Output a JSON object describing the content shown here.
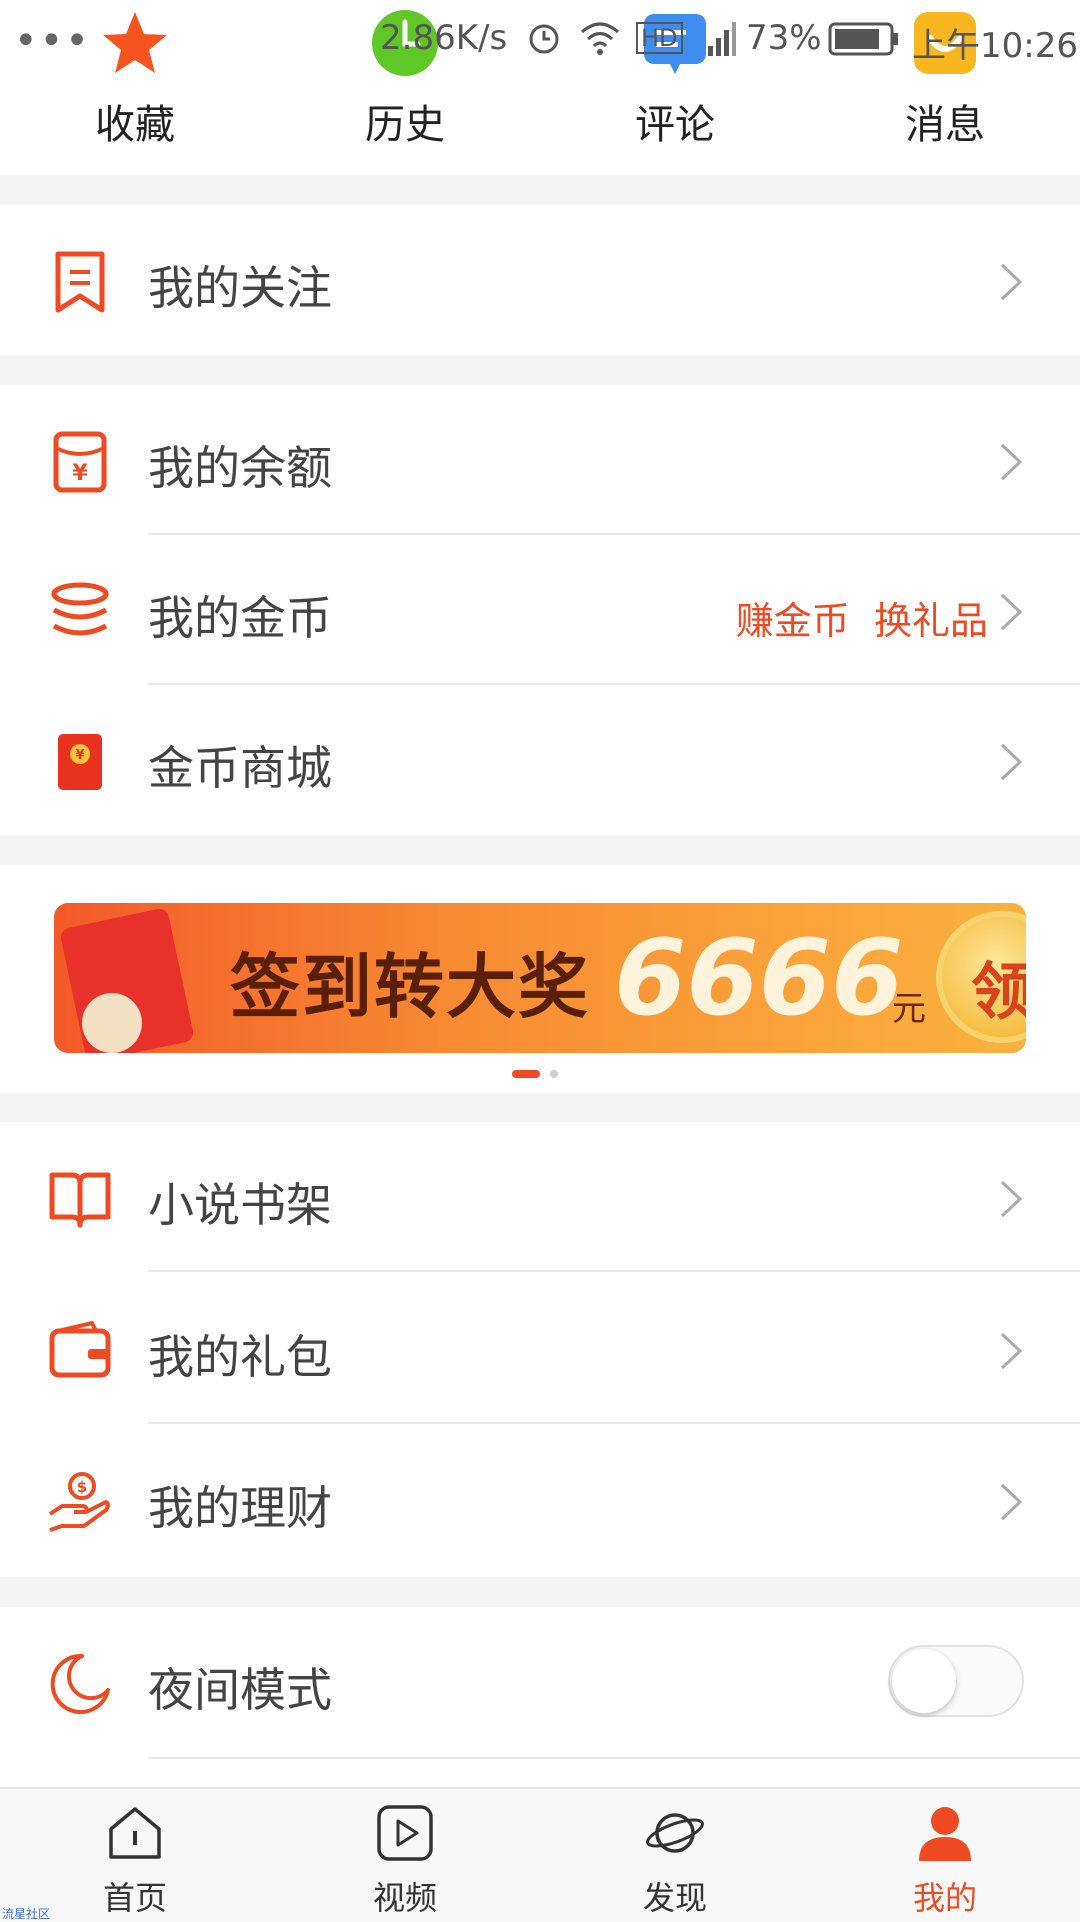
{
  "status_bar": {
    "more": "•••",
    "speed": "2.86K/s",
    "hd": "HD",
    "battery": "73%",
    "time": "上午10:26"
  },
  "shortcuts": [
    {
      "label": "收藏",
      "icon": "star-icon"
    },
    {
      "label": "历史",
      "icon": "history-icon"
    },
    {
      "label": "评论",
      "icon": "comment-icon"
    },
    {
      "label": "消息",
      "icon": "message-icon"
    }
  ],
  "menu": {
    "follow": "我的关注",
    "balance": "我的余额",
    "coins": "我的金币",
    "coins_earn": "赚金币",
    "coins_gift": "换礼品",
    "mall": "金币商城",
    "novel": "小说书架",
    "gift": "我的礼包",
    "finance": "我的理财",
    "night": "夜间模式"
  },
  "night_mode_on": false,
  "banner": {
    "title": "签到转大奖",
    "amount": "6666",
    "unit": "元",
    "claim": "领"
  },
  "bottom_nav": [
    {
      "label": "首页",
      "icon": "home-icon",
      "active": false
    },
    {
      "label": "视频",
      "icon": "video-icon",
      "active": false
    },
    {
      "label": "发现",
      "icon": "planet-icon",
      "active": false
    },
    {
      "label": "我的",
      "icon": "user-icon",
      "active": true
    }
  ],
  "watermark": "流星社区",
  "colors": {
    "accent": "#f04a22",
    "background": "#f4f4f4"
  }
}
